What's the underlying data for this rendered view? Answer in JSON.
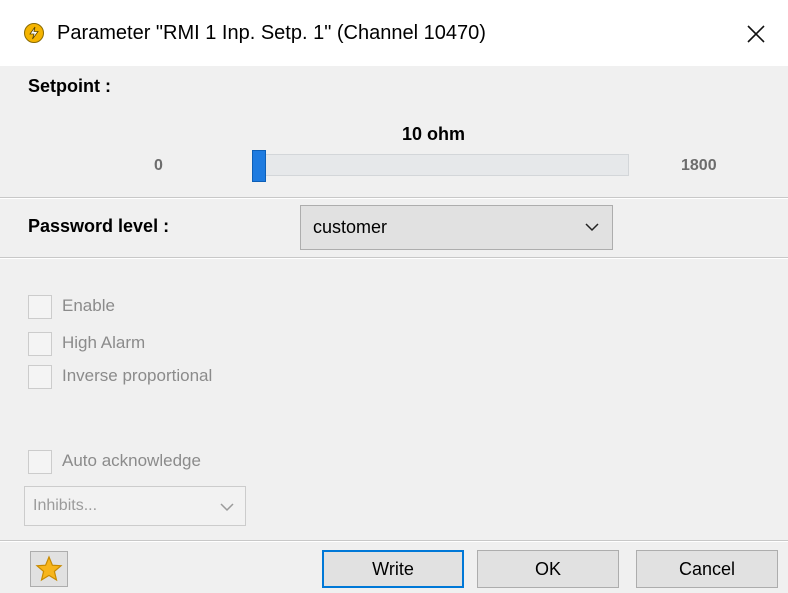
{
  "window": {
    "title": "Parameter \"RMI 1 Inp. Setp. 1\" (Channel 10470)",
    "app_icon": "lightning-icon",
    "close_icon": "close-icon"
  },
  "setpoint": {
    "label": "Setpoint :",
    "value_text": "10 ohm",
    "min_label": "0",
    "max_label": "1800",
    "value": 10,
    "min": 0,
    "max": 1800
  },
  "password": {
    "label": "Password level :",
    "selected": "customer"
  },
  "options": {
    "enable": {
      "label": "Enable",
      "checked": false
    },
    "high_alarm": {
      "label": "High Alarm",
      "checked": false
    },
    "inverse_proportional": {
      "label": "Inverse proportional",
      "checked": false
    },
    "auto_acknowledge": {
      "label": "Auto acknowledge",
      "checked": false
    },
    "inhibits": {
      "placeholder": "Inhibits..."
    }
  },
  "footer": {
    "favorite_icon": "star-icon",
    "write_label": "Write",
    "ok_label": "OK",
    "cancel_label": "Cancel"
  },
  "colors": {
    "accent": "#0078d7",
    "slider_thumb": "#1e7be0",
    "disabled_text": "#8b8b8b",
    "star": "#f7b51c"
  }
}
